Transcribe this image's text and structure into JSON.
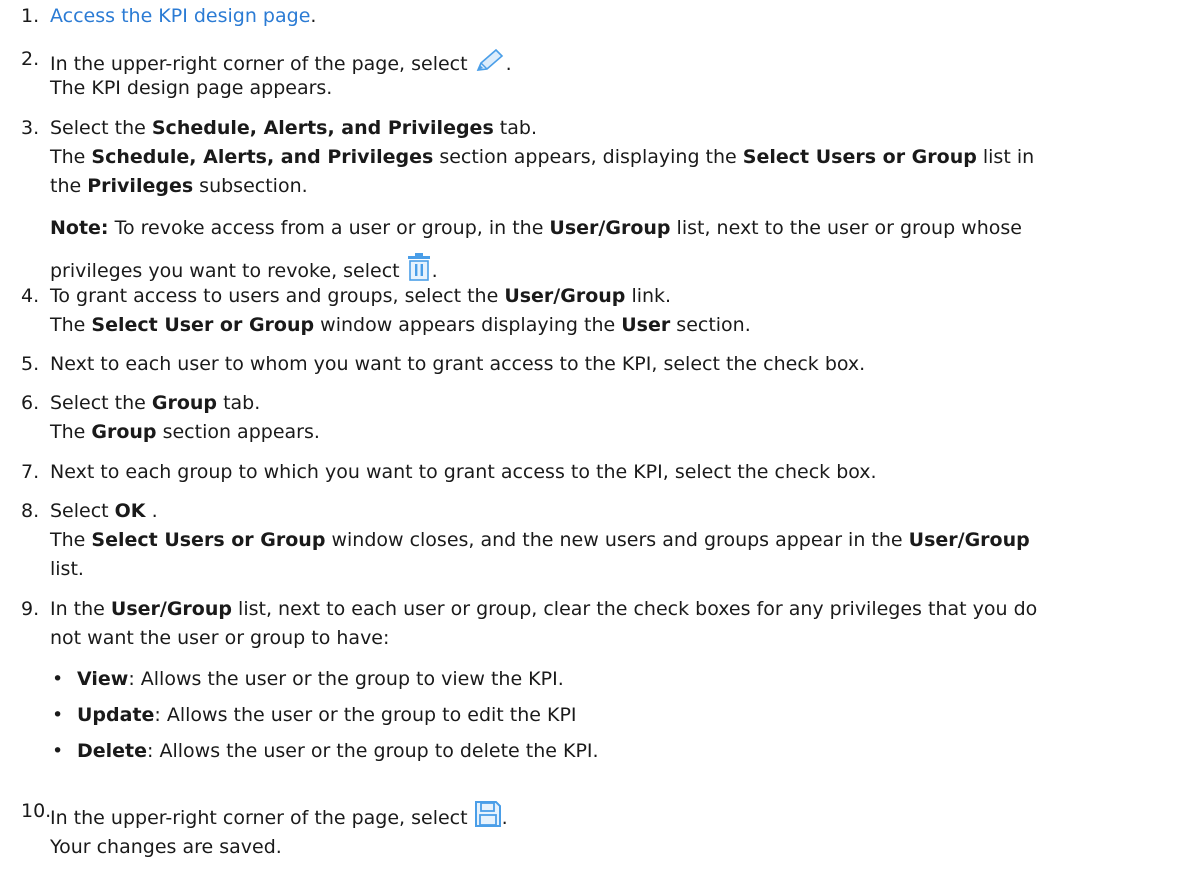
{
  "steps": [
    {
      "num": "1.",
      "link": "Access the KPI design page",
      "after": "."
    },
    {
      "num": "2.",
      "line1": "In the upper-right corner of the page, select",
      "icon": "pencil-edit-icon",
      "line1_end": ".",
      "line2": "The KPI design page appears."
    },
    {
      "num": "3.",
      "a": "Select the ",
      "b": "Schedule, Alerts, and Privileges",
      "c": " tab.",
      "d": "The ",
      "e": "Schedule, Alerts, and Privileges",
      "f": " section appears, displaying the ",
      "g": "Select Users or Group",
      "h": " list in",
      "i": "the ",
      "j": "Privileges",
      "k": " subsection."
    },
    {
      "note_label": "Note:",
      "a": " To revoke access from a user or group, in the ",
      "b": "User/Group",
      "c": " list, next to the user or group whose",
      "d": "privileges you want to revoke, select",
      "icon": "trash-icon",
      "e": "."
    },
    {
      "num": "4.",
      "a": "To grant access to users and groups, select the ",
      "b": "User/Group",
      "c": " link.",
      "d": "The ",
      "e": "Select User or Group",
      "f": " window appears displaying the ",
      "g": "User",
      "h": " section."
    },
    {
      "num": "5.",
      "a": "Next to each user to whom you want to grant access to the KPI, select the check box."
    },
    {
      "num": "6.",
      "a": "Select the ",
      "b": "Group",
      "c": " tab.",
      "d": "The ",
      "e": "Group",
      "f": " section appears."
    },
    {
      "num": "7.",
      "a": "Next to each group to which you want to grant access to the KPI, select the check box."
    },
    {
      "num": "8.",
      "a": "Select ",
      "b": "OK",
      "c": " .",
      "d": "The ",
      "e": "Select Users or Group",
      "f": " window closes, and the new users and groups appear in the ",
      "g": "User/Group",
      "h": "list."
    },
    {
      "num": "9.",
      "a": "In the ",
      "b": "User/Group",
      "c": " list, next to each user or group, clear the check boxes for any privileges that you do",
      "d": "not want the user or group to have:"
    },
    {
      "num": "10.",
      "a": "In the upper-right corner of the page, select",
      "icon": "save-icon",
      "b": ".",
      "c": "Your changes are saved."
    }
  ],
  "bullets": [
    {
      "term": "View",
      "desc": ": Allows the user or the group to view the KPI."
    },
    {
      "term": "Update",
      "desc": ": Allows the user or the group to edit the KPI"
    },
    {
      "term": "Delete",
      "desc": ": Allows the user or the group to delete the KPI."
    }
  ],
  "colors": {
    "link": "#2b7bd4",
    "icon": "#4a9ee8",
    "text": "#1a1a1a"
  }
}
